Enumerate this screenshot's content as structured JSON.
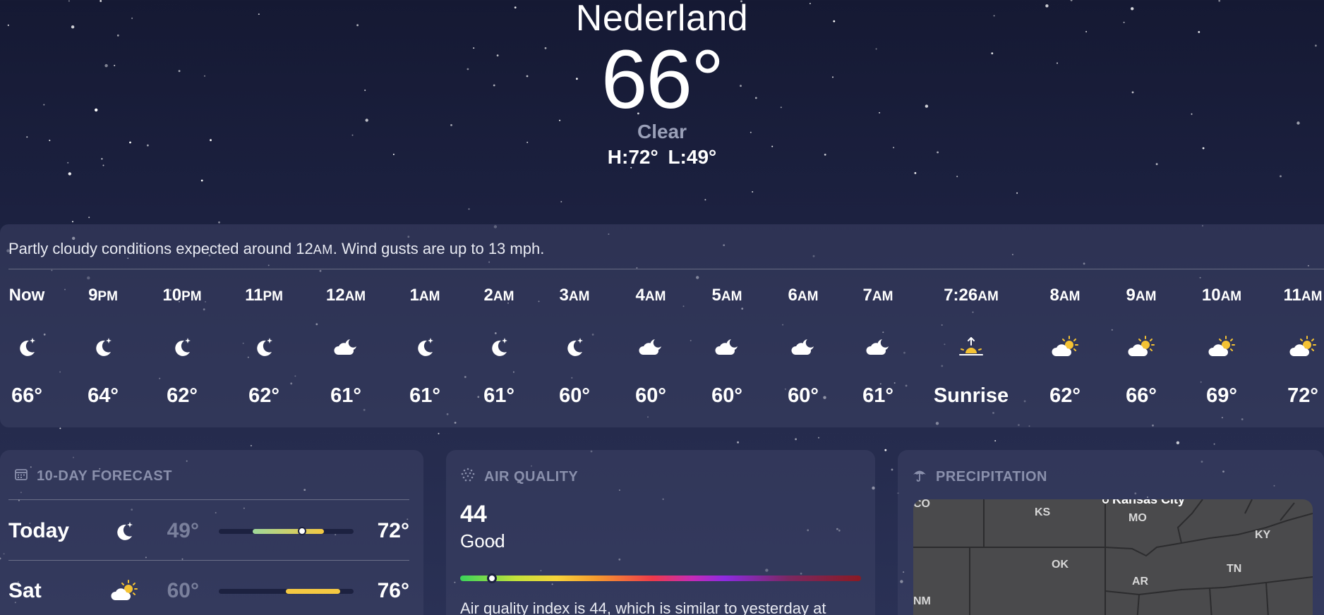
{
  "location": "Nederland",
  "current": {
    "temp": "66°",
    "condition": "Clear",
    "high_low": "H:72°  L:49°"
  },
  "hourly": {
    "summary_pre": "Partly cloudy conditions expected around 12",
    "summary_ampm": "AM",
    "summary_post": ". Wind gusts are up to 13 mph.",
    "items": [
      {
        "time": "Now",
        "ampm": "",
        "icon": "moon-star-icon",
        "value": "66°"
      },
      {
        "time": "9",
        "ampm": "PM",
        "icon": "moon-star-icon",
        "value": "64°"
      },
      {
        "time": "10",
        "ampm": "PM",
        "icon": "moon-star-icon",
        "value": "62°"
      },
      {
        "time": "11",
        "ampm": "PM",
        "icon": "moon-star-icon",
        "value": "62°"
      },
      {
        "time": "12",
        "ampm": "AM",
        "icon": "cloud-moon-icon",
        "value": "61°"
      },
      {
        "time": "1",
        "ampm": "AM",
        "icon": "moon-star-icon",
        "value": "61°"
      },
      {
        "time": "2",
        "ampm": "AM",
        "icon": "moon-star-icon",
        "value": "61°"
      },
      {
        "time": "3",
        "ampm": "AM",
        "icon": "moon-star-icon",
        "value": "60°"
      },
      {
        "time": "4",
        "ampm": "AM",
        "icon": "cloud-moon-icon",
        "value": "60°"
      },
      {
        "time": "5",
        "ampm": "AM",
        "icon": "cloud-moon-icon",
        "value": "60°"
      },
      {
        "time": "6",
        "ampm": "AM",
        "icon": "cloud-moon-icon",
        "value": "60°"
      },
      {
        "time": "7",
        "ampm": "AM",
        "icon": "cloud-moon-icon",
        "value": "61°"
      },
      {
        "time": "7:26",
        "ampm": "AM",
        "icon": "sunrise-icon",
        "value": "Sunrise"
      },
      {
        "time": "8",
        "ampm": "AM",
        "icon": "cloud-sun-icon",
        "value": "62°"
      },
      {
        "time": "9",
        "ampm": "AM",
        "icon": "cloud-sun-icon",
        "value": "66°"
      },
      {
        "time": "10",
        "ampm": "AM",
        "icon": "cloud-sun-icon",
        "value": "69°"
      },
      {
        "time": "11",
        "ampm": "AM",
        "icon": "cloud-sun-icon",
        "value": "72°"
      }
    ]
  },
  "forecast": {
    "title": "10-DAY FORECAST",
    "icon": "calendar-icon",
    "days": [
      {
        "day": "Today",
        "icon": "moon-star-icon",
        "low": "49°",
        "high": "72°",
        "range_start": 0.25,
        "range_end": 0.78,
        "current": 0.62,
        "colors": [
          "#9fd89a",
          "#f4c842"
        ]
      },
      {
        "day": "Sat",
        "icon": "cloud-sun-icon",
        "low": "60°",
        "high": "76°",
        "range_start": 0.5,
        "range_end": 0.9,
        "current": null,
        "colors": [
          "#f4c842",
          "#f4c842"
        ]
      }
    ]
  },
  "air_quality": {
    "title": "AIR QUALITY",
    "icon": "air-quality-icon",
    "value": "44",
    "label": "Good",
    "level": 0.08,
    "description": "Air quality index is 44, which is similar to yesterday at"
  },
  "precipitation": {
    "title": "PRECIPITATION",
    "icon": "umbrella-icon",
    "map_labels": {
      "co": "CO",
      "ks": "KS",
      "mo": "MO",
      "ky": "KY",
      "ok": "OK",
      "tn": "TN",
      "ar": "AR",
      "nm": "NM"
    },
    "city": "Kansas City"
  }
}
